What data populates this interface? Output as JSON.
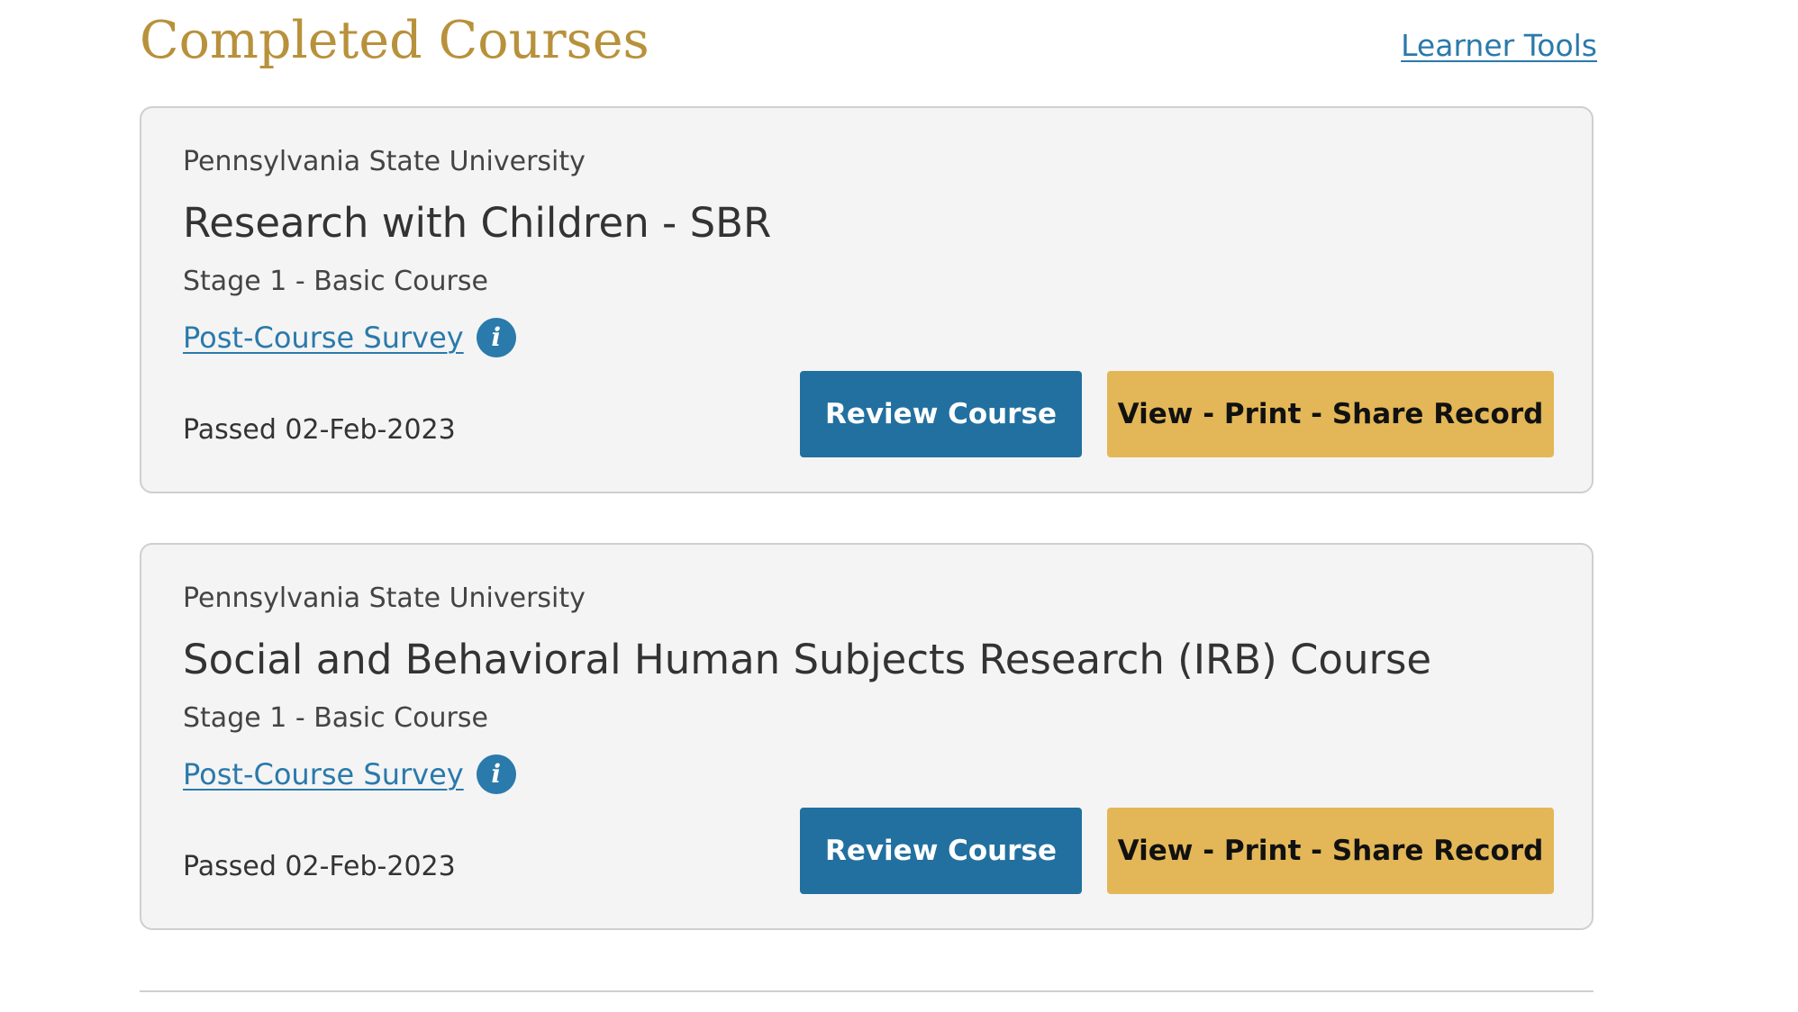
{
  "page": {
    "title": "Completed Courses",
    "learner_tools_label": "Learner Tools"
  },
  "courses": [
    {
      "institution": "Pennsylvania State University",
      "title": "Research with Children - SBR",
      "stage": "Stage 1 - Basic Course",
      "survey_label": "Post-Course Survey",
      "info_icon": "i",
      "passed": "Passed 02-Feb-2023",
      "review_label": "Review Course",
      "record_label": "View - Print - Share Record"
    },
    {
      "institution": "Pennsylvania State University",
      "title": "Social and Behavioral Human Subjects Research (IRB) Course",
      "stage": "Stage 1 - Basic Course",
      "survey_label": "Post-Course Survey",
      "info_icon": "i",
      "passed": "Passed 02-Feb-2023",
      "review_label": "Review Course",
      "record_label": "View - Print - Share Record"
    }
  ],
  "colors": {
    "title_gold": "#b8913b",
    "link_blue": "#2a7aab",
    "review_button": "#22709f",
    "record_button": "#e3b757",
    "card_background": "#f4f4f4",
    "card_border": "#cfcfcf"
  },
  "icons": {
    "info": "info-circle-icon"
  }
}
